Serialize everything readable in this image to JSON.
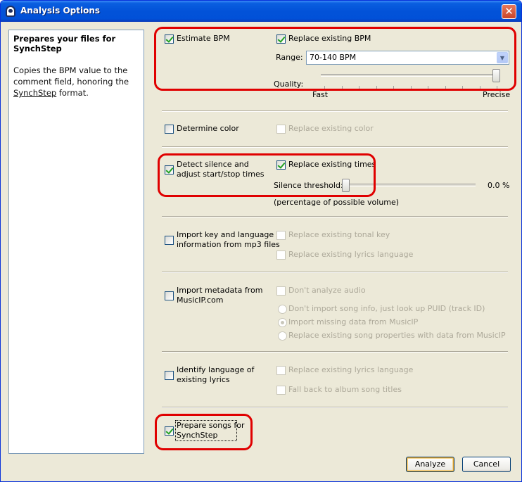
{
  "window": {
    "title": "Analysis Options"
  },
  "description": {
    "title": "Prepares your files for SynchStep",
    "body_line1": "Copies the BPM value to the",
    "body_line2": "comment field, honoring the",
    "body_link": "SynchStep",
    "body_end": " format."
  },
  "bpm": {
    "estimate_label": "Estimate BPM",
    "estimate_checked": true,
    "replace_label": "Replace existing BPM",
    "replace_checked": true,
    "range_label": "Range:",
    "range_value": "70-140 BPM",
    "quality_label": "Quality:",
    "quality_min": "Fast",
    "quality_max": "Precise",
    "quality_level": 1.0
  },
  "color": {
    "determine_label": "Determine color",
    "determine_checked": false,
    "replace_label": "Replace existing color"
  },
  "silence": {
    "detect_label_1": "Detect silence and",
    "detect_label_2": "adjust start/stop times",
    "detect_checked": true,
    "replace_label": "Replace existing times",
    "replace_checked": true,
    "threshold_label": "Silence threshold:",
    "threshold_value": "0.0 %",
    "threshold_level": 0.0,
    "note": "(percentage of possible volume)"
  },
  "key": {
    "import_label_1": "Import key and language",
    "import_label_2": "information from mp3 files",
    "import_checked": false,
    "replace_tonal_label": "Replace existing tonal key",
    "replace_lyrics_label": "Replace existing lyrics language"
  },
  "musicip": {
    "import_label_1": "Import metadata from",
    "import_label_2": "MusicIP.com",
    "import_checked": false,
    "dont_analyze_label": "Don't analyze audio",
    "options": [
      "Don't import song info, just look up PUID (track ID)",
      "Import missing data from MusicIP",
      "Replace existing song properties with data from MusicIP"
    ],
    "selected_option": 1
  },
  "lyrics": {
    "identify_label_1": "Identify language of",
    "identify_label_2": "existing lyrics",
    "identify_checked": false,
    "replace_label": "Replace existing lyrics language",
    "fallback_label": "Fall back to album song titles"
  },
  "synchstep": {
    "prepare_label_1": "Prepare songs for",
    "prepare_label_2": "SynchStep",
    "prepare_checked": true
  },
  "buttons": {
    "analyze": "Analyze",
    "cancel": "Cancel"
  }
}
